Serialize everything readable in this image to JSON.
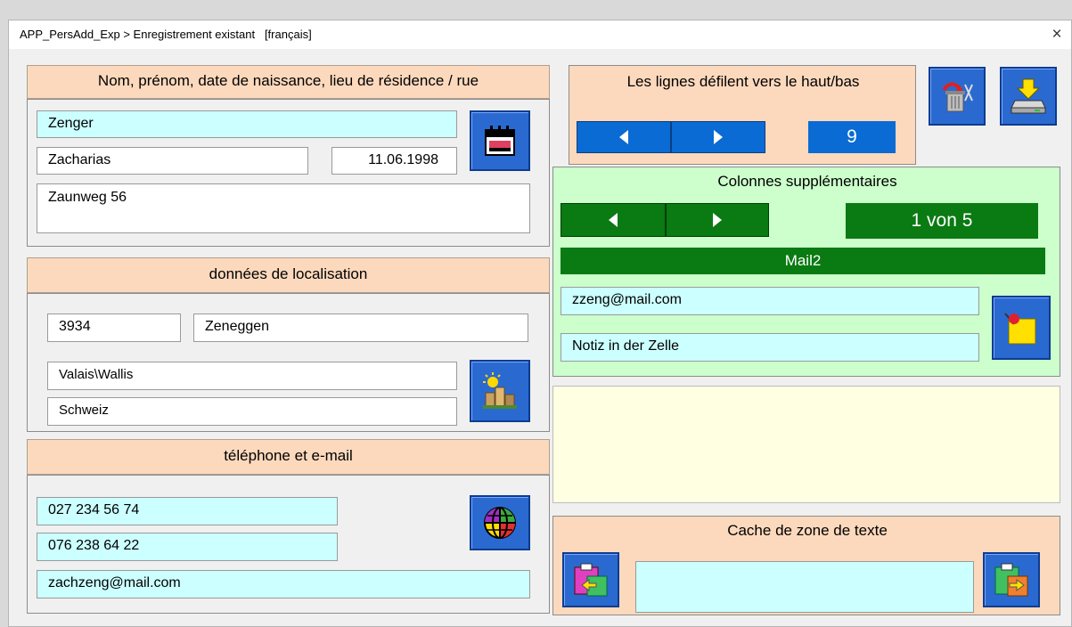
{
  "window": {
    "title": "APP_PersAdd_Exp > Enregistrement existant   [français]",
    "close_label": "×"
  },
  "personal": {
    "header": "Nom, prénom, date de naissance, lieu de résidence / rue",
    "last_name": "Zenger",
    "first_name": "Zacharias",
    "birth_date": "11.06.1998",
    "street": "Zaunweg 56",
    "calendar_icon": "calendar-icon"
  },
  "location": {
    "header": "données de localisation",
    "zip": "3934",
    "city": "Zeneggen",
    "canton": "Valais\\Wallis",
    "country": "Schweiz",
    "map_icon": "city-landscape-icon"
  },
  "contact": {
    "header": "téléphone et e-mail",
    "phone1": "027 234 56 74",
    "phone2": "076 238 64 22",
    "email": "zachzeng@mail.com",
    "globe_icon": "globe-icon"
  },
  "rows_nav": {
    "header": "Les lignes défilent vers le haut/bas",
    "value": "9",
    "prev_icon": "triangle-left-icon",
    "next_icon": "triangle-right-icon"
  },
  "toolbar": {
    "delete_icon": "trash-icon",
    "save_icon": "save-drive-icon"
  },
  "extra_cols": {
    "header": "Colonnes supplémentaires",
    "counter": "1 von 5",
    "column_name": "Mail2",
    "value": "zzeng@mail.com",
    "note": "Notiz in der Zelle",
    "note_icon": "sticky-note-pin-icon"
  },
  "text_cache": {
    "header": "Cache de zone de texte",
    "value": "",
    "paste_icon": "clipboard-paste-icon",
    "copy_icon": "clipboard-copy-icon"
  },
  "colors": {
    "header_bg": "#fcd9bd",
    "cyan_field": "#ccffff",
    "blue_button": "#0a6bd4",
    "green_button": "#0a7a12",
    "green_panel": "#ccffcc",
    "memo_bg": "#ffffe1"
  }
}
